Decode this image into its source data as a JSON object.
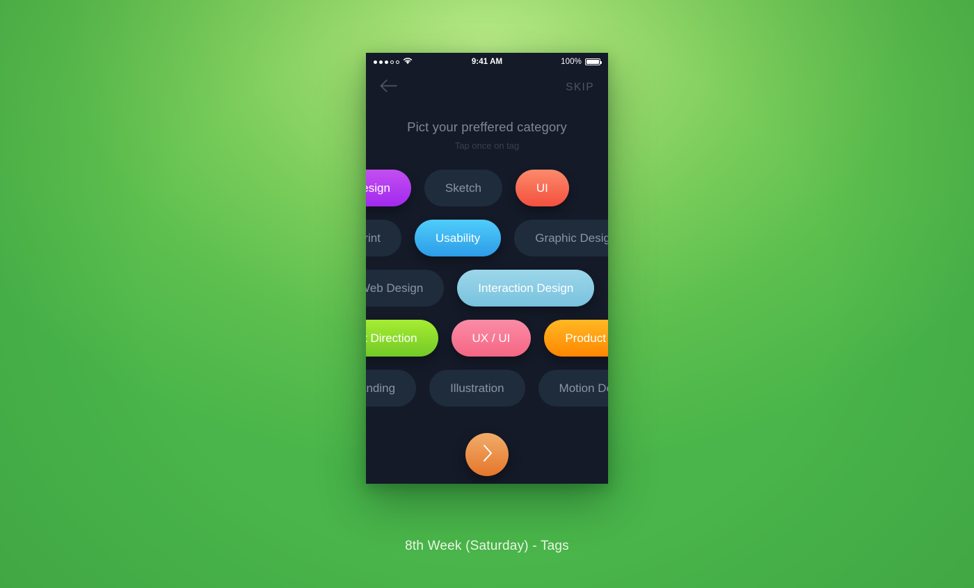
{
  "status_bar": {
    "signal_dots_filled": 3,
    "signal_dots_empty": 2,
    "wifi_icon": "wifi-icon",
    "time": "9:41 AM",
    "battery_percent": "100%",
    "battery_icon": "battery-full-icon"
  },
  "nav": {
    "back_icon": "arrow-left-icon",
    "skip_label": "SKIP"
  },
  "titles": {
    "headline": "Pict your preffered category",
    "subhead": "Tap once on tag"
  },
  "tag_rows": [
    {
      "tags": [
        {
          "label": "Design",
          "selected": true,
          "color_class": "c-purple",
          "color": "#a229ef"
        },
        {
          "label": "Sketch",
          "selected": false,
          "color_class": "",
          "color": "#1e2c3c"
        },
        {
          "label": "UI",
          "selected": true,
          "color_class": "c-coral",
          "color": "#f4503e"
        }
      ]
    },
    {
      "tags": [
        {
          "label": "Print",
          "selected": false,
          "color_class": "",
          "color": "#1e2c3c"
        },
        {
          "label": "Usability",
          "selected": true,
          "color_class": "c-blue",
          "color": "#2c9ce8"
        },
        {
          "label": "Graphic Design",
          "selected": false,
          "color_class": "",
          "color": "#1e2c3c"
        }
      ]
    },
    {
      "tags": [
        {
          "label": "Web Design",
          "selected": false,
          "color_class": "",
          "color": "#1e2c3c"
        },
        {
          "label": "Interaction Design",
          "selected": true,
          "color_class": "c-skyblue",
          "color": "#79c2de"
        }
      ]
    },
    {
      "tags": [
        {
          "label": "Art Direction",
          "selected": true,
          "color_class": "c-green",
          "color": "#73ca27"
        },
        {
          "label": "UX / UI",
          "selected": true,
          "color_class": "c-pink",
          "color": "#f56684"
        },
        {
          "label": "Product Design",
          "selected": true,
          "color_class": "c-orange",
          "color": "#ff8700"
        }
      ]
    },
    {
      "tags": [
        {
          "label": "Branding",
          "selected": false,
          "color_class": "",
          "color": "#1e2c3c"
        },
        {
          "label": "Illustration",
          "selected": false,
          "color_class": "",
          "color": "#1e2c3c"
        },
        {
          "label": "Motion Design",
          "selected": false,
          "color_class": "",
          "color": "#1e2c3c"
        }
      ]
    }
  ],
  "next_button": {
    "icon": "chevron-right-icon",
    "color": "#e4762a"
  },
  "caption": "8th Week (Saturday) - Tags",
  "theme": {
    "backdrop_green": "#5cbf4e",
    "screen_bg": "#141a28",
    "tag_dark": "#1e2c3c",
    "tag_text": "#8b95a3"
  }
}
